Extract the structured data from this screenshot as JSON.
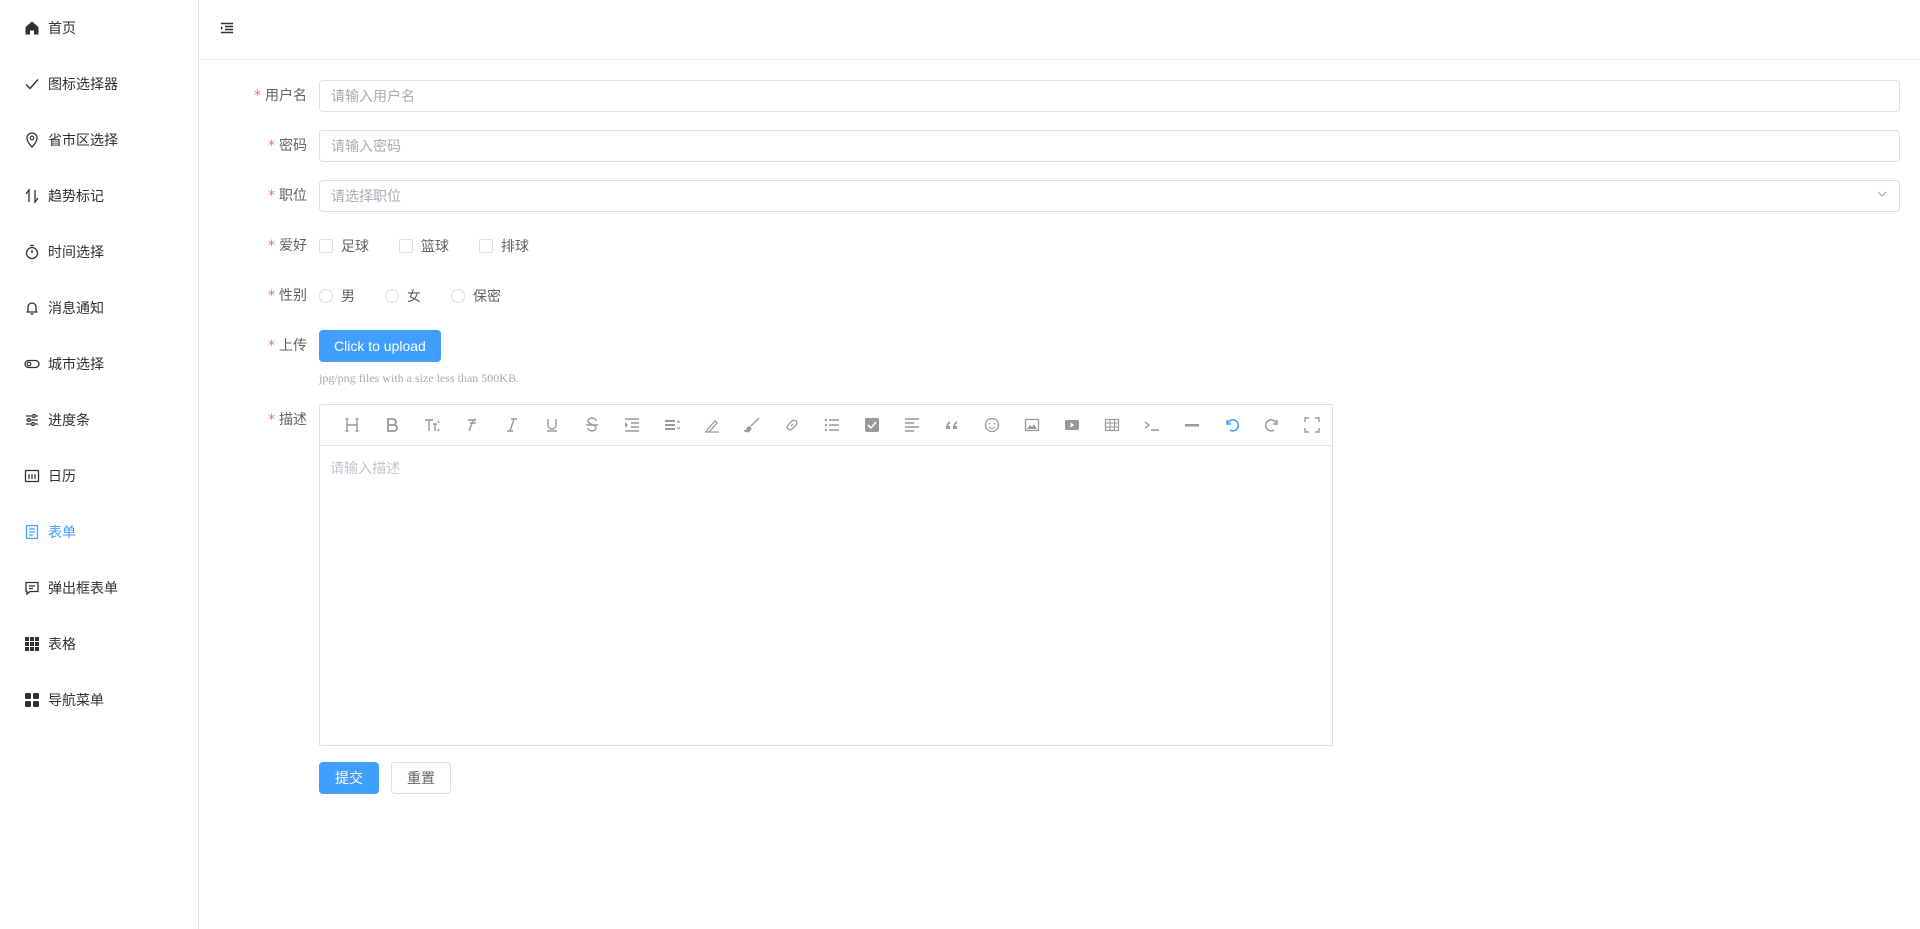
{
  "sidebar": {
    "items": [
      {
        "label": "首页",
        "icon": "home-icon"
      },
      {
        "label": "图标选择器",
        "icon": "check-icon"
      },
      {
        "label": "省市区选择",
        "icon": "location-icon"
      },
      {
        "label": "趋势标记",
        "icon": "sort-icon"
      },
      {
        "label": "时间选择",
        "icon": "stopwatch-icon"
      },
      {
        "label": "消息通知",
        "icon": "bell-icon"
      },
      {
        "label": "城市选择",
        "icon": "toggle-icon"
      },
      {
        "label": "进度条",
        "icon": "sliders-icon"
      },
      {
        "label": "日历",
        "icon": "calendar-icon"
      },
      {
        "label": "表单",
        "icon": "document-icon",
        "active": true
      },
      {
        "label": "弹出框表单",
        "icon": "chat-icon"
      },
      {
        "label": "表格",
        "icon": "grid-icon"
      },
      {
        "label": "导航菜单",
        "icon": "menu-icon"
      }
    ]
  },
  "header": {
    "toggle_icon": "fold-icon"
  },
  "form": {
    "username": {
      "label": "用户名",
      "placeholder": "请输入用户名"
    },
    "password": {
      "label": "密码",
      "placeholder": "请输入密码"
    },
    "position": {
      "label": "职位",
      "placeholder": "请选择职位"
    },
    "hobby": {
      "label": "爱好",
      "options": [
        "足球",
        "篮球",
        "排球"
      ]
    },
    "gender": {
      "label": "性别",
      "options": [
        "男",
        "女",
        "保密"
      ]
    },
    "upload": {
      "label": "上传",
      "button": "Click to upload",
      "tip": "jpg/png files with a size less than 500KB."
    },
    "description": {
      "label": "描述",
      "placeholder": "请输入描述"
    },
    "required_mark": "*"
  },
  "buttons": {
    "submit": "提交",
    "reset": "重置"
  },
  "colors": {
    "primary": "#409eff",
    "required": "#f56c6c",
    "text": "#303133"
  }
}
